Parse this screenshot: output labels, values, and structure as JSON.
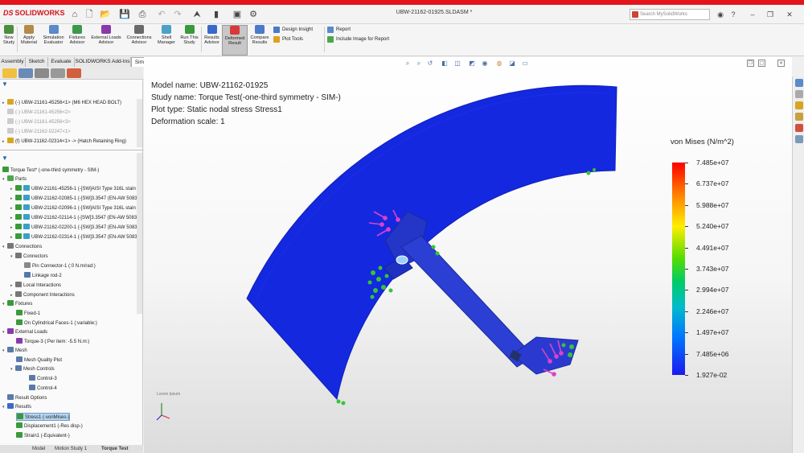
{
  "app": {
    "brand": "SOLIDWORKS",
    "document_title": "UBW-21162-01925.SLDASM *",
    "search_placeholder": "Search MySolidWorks"
  },
  "ribbon": {
    "buttons": [
      {
        "label1": "New",
        "label2": "Study"
      },
      {
        "label1": "Apply",
        "label2": "Material"
      },
      {
        "label1": "Simulation",
        "label2": "Evaluator"
      },
      {
        "label1": "Fixtures",
        "label2": "Advisor"
      },
      {
        "label1": "External Loads",
        "label2": "Advisor"
      },
      {
        "label1": "Connections",
        "label2": "Advisor"
      },
      {
        "label1": "Shell",
        "label2": "Manager"
      },
      {
        "label1": "Run This",
        "label2": "Study"
      },
      {
        "label1": "Results",
        "label2": "Advisor"
      },
      {
        "label1": "Deformed",
        "label2": "Result"
      },
      {
        "label1": "Compare",
        "label2": "Results"
      }
    ],
    "design_insight": "Design Insight",
    "plot_tools": "Plot Tools",
    "report": "Report",
    "include_image": "Include Image for Report"
  },
  "command_tabs": [
    "Assembly",
    "Sketch",
    "Evaluate",
    "SOLIDWORKS Add-Ins",
    "Simulation"
  ],
  "tree_top": [
    {
      "label": "(-) UBW-21161-45256<1> (M6 HEX HEAD BOLT)",
      "dim": false
    },
    {
      "label": "(-) UBW-21161-45256<2>",
      "dim": true
    },
    {
      "label": "(-) UBW-21161-45256<3>",
      "dim": true
    },
    {
      "label": "(-) UBW-21162-02247<1>",
      "dim": true
    },
    {
      "label": "(f) UBW-21162-02314<1> -> (Hatch Retaining Ring)",
      "dim": false
    }
  ],
  "study_tree": {
    "study": "Torque Test* (-one-third symmetry - SIM-)",
    "parts_label": "Parts",
    "parts": [
      "UBW-21161-45256-1 (-[SW]AISI Type 316L stain",
      "UBW-21162-02085-1 (-[SW]3.3547 (EN-AW 5083",
      "UBW-21162-02096-1 (-[SW]AISI Type 316L stain",
      "UBW-21162-02114-1 (-[SW]3.3547 (EN-AW 5083",
      "UBW-21162-02200-1 (-[SW]3.3547 (EN-AW 5083",
      "UBW-21162-02314-1 (-[SW]3.3547 (EN-AW 5083"
    ],
    "connections": "Connections",
    "connectors": "Connectors",
    "pin_connector": "Pin Connector-1 (:0 N.m/rad:)",
    "linkage_rod": "Linkage rod-2",
    "local_interactions": "Local Interactions",
    "component_interactions": "Component Interactions",
    "fixtures": "Fixtures",
    "fixed": "Fixed-1",
    "cyl_faces": "On Cylindrical Faces-1 (:variable:)",
    "external_loads": "External Loads",
    "torque": "Torque-3 (:Per item: -5.5 N.m:)",
    "mesh": "Mesh",
    "mesh_quality": "Mesh Quality Plot",
    "mesh_controls": "Mesh Controls",
    "control3": "Control-3",
    "control4": "Control-4",
    "result_options": "Result Options",
    "results": "Results",
    "stress": "Stress1 (-vonMises-)",
    "displacement": "Displacement1 (-Res disp-)",
    "strain": "Strain1 (-Equivalent-)"
  },
  "bottom_tabs": [
    "Model",
    "Motion Study 1",
    "Torque Test"
  ],
  "plot_info": {
    "model_name": "Model name: UBW-21162-01925",
    "study_name": "Study name: Torque Test(-one-third symmetry - SIM-)",
    "plot_type": "Plot type: Static nodal stress Stress1",
    "deformation_scale": "Deformation scale: 1"
  },
  "triad_label": "Lorem Ipsum",
  "legend": {
    "title": "von Mises (N/m^2)",
    "ticks": [
      "7.485e+07",
      "6.737e+07",
      "5.988e+07",
      "5.240e+07",
      "4.491e+07",
      "3.743e+07",
      "2.994e+07",
      "2.246e+07",
      "1.497e+07",
      "7.485e+06",
      "1.927e-02"
    ],
    "colors": {
      "max": "#ff0000",
      "mid": "#55dd00",
      "min": "#1a1aee"
    }
  }
}
